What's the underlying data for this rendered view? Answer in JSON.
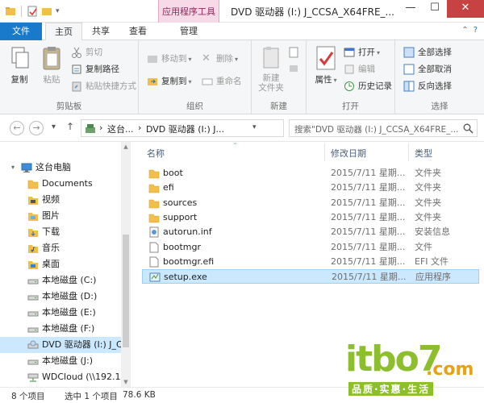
{
  "window": {
    "title": "DVD 驱动器 (I:) J_CCSA_X64FRE_...",
    "contextual_tab_group": "应用程序工具"
  },
  "ribbon_tabs": {
    "file": "文件",
    "home": "主页",
    "share": "共享",
    "view": "查看",
    "manage": "管理"
  },
  "ribbon": {
    "clipboard": {
      "label": "剪贴板",
      "copy": "复制",
      "paste": "粘贴",
      "cut": "剪切",
      "copy_path": "复制路径",
      "paste_shortcut": "粘贴快捷方式"
    },
    "organize": {
      "label": "组织",
      "move_to": "移动到",
      "copy_to": "复制到",
      "delete": "删除",
      "rename": "重命名"
    },
    "new": {
      "label": "新建",
      "new_folder": "新建\n文件夹"
    },
    "open": {
      "label": "打开",
      "properties": "属性",
      "open": "打开",
      "edit": "编辑",
      "history": "历史记录"
    },
    "select": {
      "label": "选择",
      "select_all": "全部选择",
      "select_none": "全部取消",
      "invert": "反向选择"
    }
  },
  "address": {
    "crumb1": "这台...",
    "crumb2": "DVD 驱动器 (I:) J...",
    "search_placeholder": "搜索\"DVD 驱动器 (I:) J_CCSA_X64FRE_..."
  },
  "nav": {
    "items": [
      {
        "label": "这台电脑",
        "icon": "computer-icon"
      },
      {
        "label": "Documents",
        "icon": "folder-icon"
      },
      {
        "label": "视频",
        "icon": "video-folder-icon"
      },
      {
        "label": "图片",
        "icon": "pictures-folder-icon"
      },
      {
        "label": "下载",
        "icon": "download-folder-icon"
      },
      {
        "label": "音乐",
        "icon": "music-folder-icon"
      },
      {
        "label": "桌面",
        "icon": "desktop-folder-icon"
      },
      {
        "label": "本地磁盘 (C:)",
        "icon": "drive-icon"
      },
      {
        "label": "本地磁盘 (D:)",
        "icon": "drive-icon"
      },
      {
        "label": "本地磁盘 (E:)",
        "icon": "drive-icon"
      },
      {
        "label": "本地磁盘 (F:)",
        "icon": "drive-icon"
      },
      {
        "label": "DVD 驱动器 (I:) J_CC",
        "icon": "dvd-drive-icon"
      },
      {
        "label": "本地磁盘 (J:)",
        "icon": "drive-icon"
      },
      {
        "label": "WDCloud (\\\\192.168",
        "icon": "network-drive-icon"
      }
    ]
  },
  "columns": {
    "name": "名称",
    "date": "修改日期",
    "type": "类型"
  },
  "files": [
    {
      "name": "boot",
      "date": "2015/7/11 星期...",
      "type": "文件夹",
      "icon": "folder-icon"
    },
    {
      "name": "efi",
      "date": "2015/7/11 星期...",
      "type": "文件夹",
      "icon": "folder-icon"
    },
    {
      "name": "sources",
      "date": "2015/7/11 星期...",
      "type": "文件夹",
      "icon": "folder-icon"
    },
    {
      "name": "support",
      "date": "2015/7/11 星期...",
      "type": "文件夹",
      "icon": "folder-icon"
    },
    {
      "name": "autorun.inf",
      "date": "2015/7/11 星期...",
      "type": "安装信息",
      "icon": "setup-info-icon"
    },
    {
      "name": "bootmgr",
      "date": "2015/7/11 星期...",
      "type": "文件",
      "icon": "file-icon"
    },
    {
      "name": "bootmgr.efi",
      "date": "2015/7/11 星期...",
      "type": "EFI 文件",
      "icon": "file-icon"
    },
    {
      "name": "setup.exe",
      "date": "2015/7/11 星期...",
      "type": "应用程序",
      "icon": "setup-exe-icon"
    }
  ],
  "status": {
    "count": "8 个项目",
    "selected": "选中 1 个项目",
    "size": "78.6 KB"
  },
  "watermark": {
    "logo": "itbo7",
    "com": ".com",
    "slogan": "品质·实惠·生活"
  },
  "colors": {
    "accent": "#1979ca",
    "selection": "#cce8ff",
    "context_tab": "#f7d9e8",
    "folder": "#f2c04a"
  }
}
